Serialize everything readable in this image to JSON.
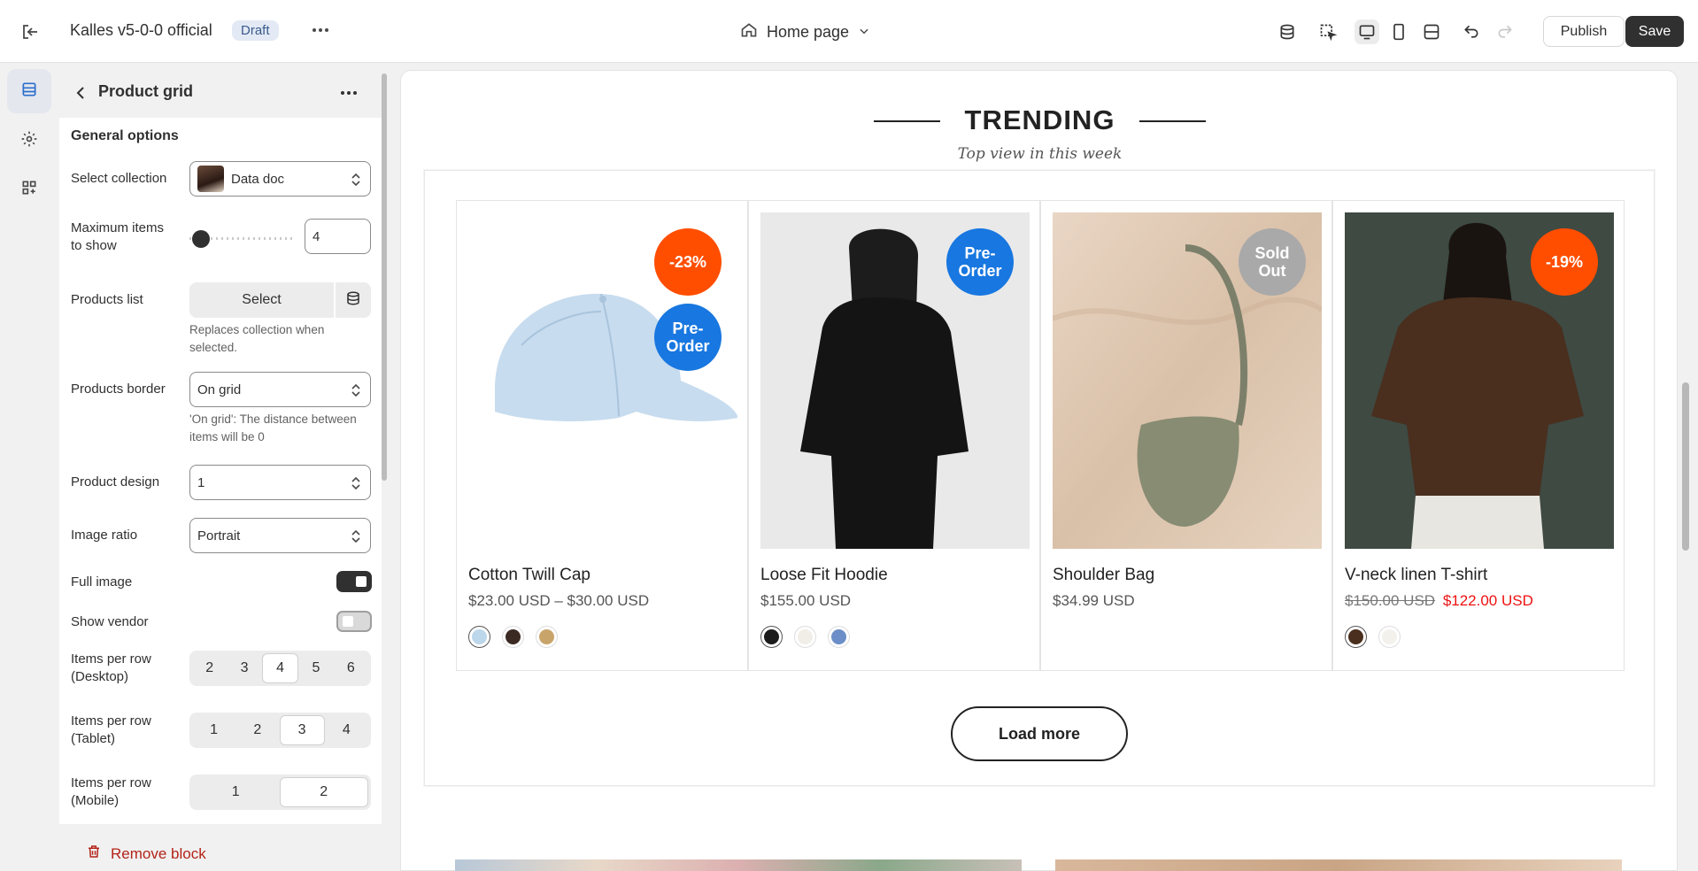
{
  "topbar": {
    "store_name": "Kalles v5-0-0 official",
    "status_badge": "Draft",
    "page_selector": "Home page",
    "publish_label": "Publish",
    "save_label": "Save"
  },
  "sidebar": {
    "title": "Product grid",
    "section_title": "General options",
    "select_collection": {
      "label": "Select collection",
      "value": "Data doc"
    },
    "max_items": {
      "label": "Maximum items to show",
      "value": "4"
    },
    "products_list": {
      "label": "Products list",
      "button": "Select",
      "help": "Replaces collection when selected."
    },
    "products_border": {
      "label": "Products border",
      "value": "On grid",
      "help": "'On grid': The distance between items will be 0"
    },
    "product_design": {
      "label": "Product design",
      "value": "1"
    },
    "image_ratio": {
      "label": "Image ratio",
      "value": "Portrait"
    },
    "full_image": {
      "label": "Full image",
      "on": true
    },
    "show_vendor": {
      "label": "Show vendor",
      "on": false
    },
    "per_row_desktop": {
      "label": "Items per row (Desktop)",
      "options": [
        "2",
        "3",
        "4",
        "5",
        "6"
      ],
      "selected": "4"
    },
    "per_row_tablet": {
      "label": "Items per row (Tablet)",
      "options": [
        "1",
        "2",
        "3",
        "4"
      ],
      "selected": "3"
    },
    "per_row_mobile": {
      "label": "Items per row (Mobile)",
      "options": [
        "1",
        "2"
      ],
      "selected": "2"
    },
    "remove_block": "Remove block"
  },
  "preview": {
    "heading": "TRENDING",
    "subheading": "Top view in this week",
    "load_more": "Load more",
    "products": [
      {
        "name": "Cotton Twill Cap",
        "price": "$23.00 USD – $30.00 USD",
        "badges": [
          "-23%",
          "Pre-Order"
        ],
        "swatches": [
          "#bcd6ea",
          "#3b2a22",
          "#c9a46a"
        ]
      },
      {
        "name": "Loose Fit Hoodie",
        "price": "$155.00 USD",
        "badges": [
          "Pre-Order"
        ],
        "swatches": [
          "#1b1b1b",
          "#f1eee8",
          "#6b8ec8"
        ]
      },
      {
        "name": "Shoulder Bag",
        "price": "$34.99 USD",
        "badges": [
          "Sold Out"
        ],
        "swatches": []
      },
      {
        "name": "V-neck linen T-shirt",
        "old_price": "$150.00 USD",
        "new_price": "$122.00 USD",
        "badges": [
          "-19%"
        ],
        "swatches": [
          "#4a2e1e",
          "#f3f1ec"
        ]
      }
    ]
  },
  "colors": {
    "sale": "#ff4e00",
    "preorder": "#1877e0",
    "soldout": "#a9a9a9",
    "accent_dark": "#303030",
    "danger": "#b42318"
  }
}
